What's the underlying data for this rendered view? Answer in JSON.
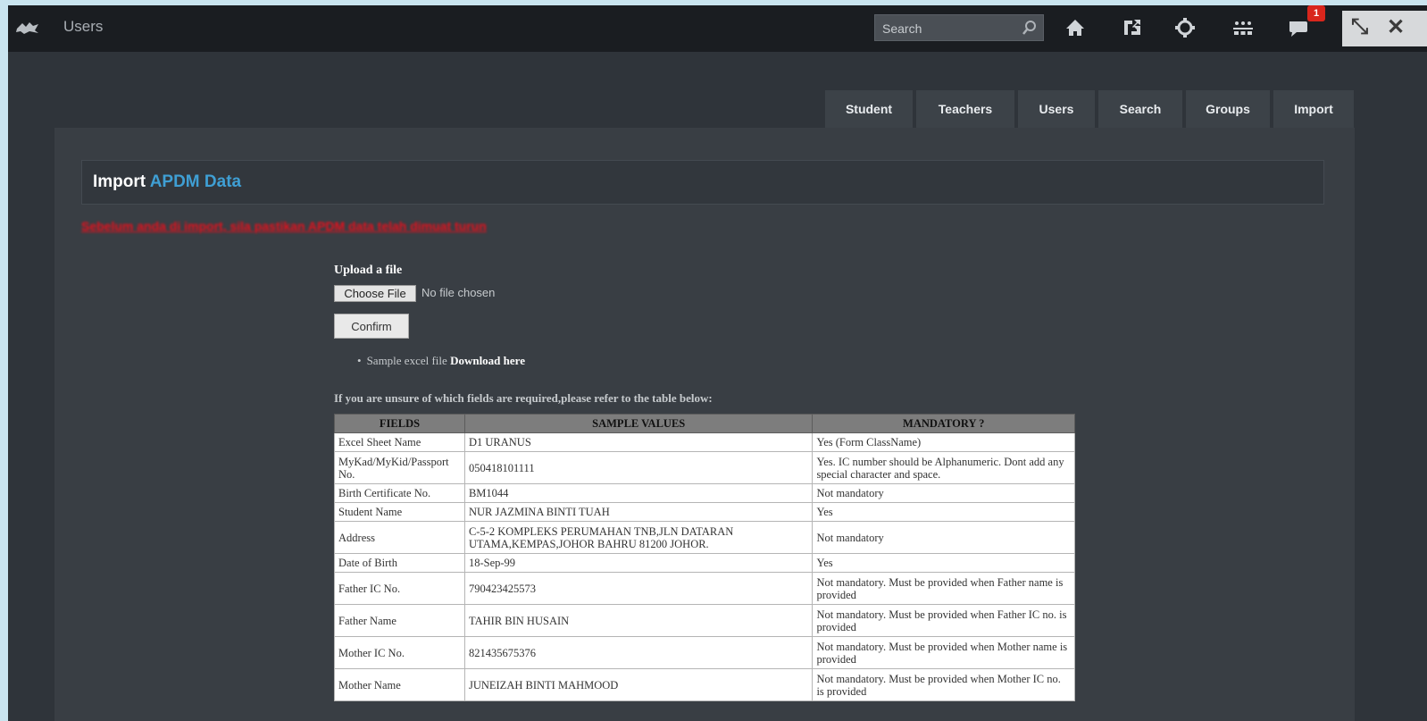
{
  "topbar": {
    "title": "Users",
    "search_placeholder": "Search",
    "notification_count": "1",
    "icons": [
      "logo-icon",
      "home-icon",
      "share-icon",
      "settings-icon",
      "people-icon",
      "messages-icon",
      "collapse-icon",
      "close-icon"
    ]
  },
  "tabs": [
    "Student",
    "Teachers",
    "Users",
    "Search",
    "Groups",
    "Import"
  ],
  "page": {
    "title_prefix": "Import",
    "title_accent": "APDM Data",
    "warning": "Sebelum anda di import, sila pastikan APDM data telah dimuat turun",
    "upload_label": "Upload a file",
    "choose_file": "Choose File",
    "no_file": "No file chosen",
    "confirm": "Confirm",
    "sample_text": "Sample excel file",
    "download_link": "Download here",
    "refer_text": "If you are unsure of which fields are required,please refer to the table below:"
  },
  "table": {
    "headers": [
      "FIELDS",
      "SAMPLE VALUES",
      "MANDATORY ?"
    ],
    "rows": [
      [
        "Excel Sheet Name",
        "D1 URANUS",
        "Yes (Form ClassName)"
      ],
      [
        "MyKad/MyKid/Passport No.",
        "050418101111",
        "Yes. IC number should be Alphanumeric. Dont add any special character and space."
      ],
      [
        "Birth Certificate No.",
        "BM1044",
        "Not mandatory"
      ],
      [
        "Student Name",
        "NUR JAZMINA BINTI TUAH",
        "Yes"
      ],
      [
        "Address",
        "C-5-2 KOMPLEKS PERUMAHAN TNB,JLN DATARAN UTAMA,KEMPAS,JOHOR BAHRU 81200 JOHOR.",
        "Not mandatory"
      ],
      [
        "Date of Birth",
        "18-Sep-99",
        "Yes"
      ],
      [
        "Father IC No.",
        "790423425573",
        "Not mandatory. Must be provided when Father name is provided"
      ],
      [
        "Father Name",
        "TAHIR BIN HUSAIN",
        "Not mandatory. Must be provided when Father IC no. is provided"
      ],
      [
        "Mother IC No.",
        "821435675376",
        "Not mandatory. Must be provided when Mother name is provided"
      ],
      [
        "Mother Name",
        "JUNEIZAH BINTI MAHMOOD",
        "Not mandatory. Must be provided when Mother IC no. is provided"
      ]
    ]
  },
  "colors": {
    "accent": "#3f9fd4",
    "warning": "#e8101c",
    "badge": "#d9261c"
  }
}
